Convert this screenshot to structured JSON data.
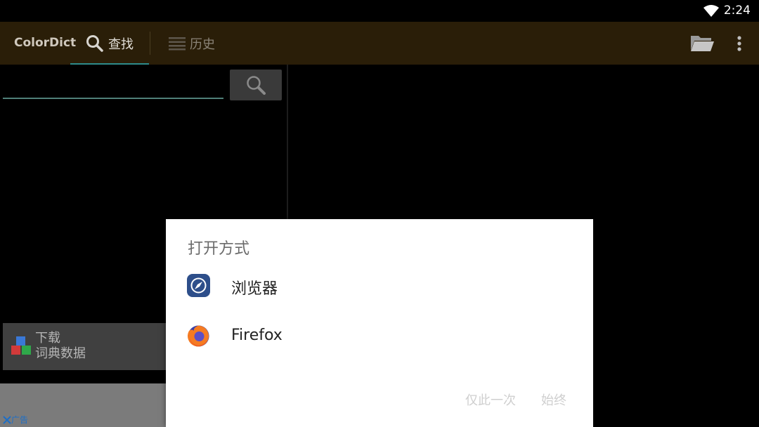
{
  "status_bar": {
    "time": "2:24"
  },
  "app_bar": {
    "title": "ColorDict",
    "tabs": [
      {
        "label": "查找",
        "icon": "search-icon",
        "active": true
      },
      {
        "label": "历史",
        "icon": "list-icon",
        "active": false
      }
    ]
  },
  "search": {
    "value": ""
  },
  "download": {
    "line1": "下载",
    "line2": "词典数据"
  },
  "ad": {
    "label": "广告"
  },
  "dialog": {
    "title": "打开方式",
    "items": [
      {
        "label": "浏览器",
        "icon": "compass-icon"
      },
      {
        "label": "Firefox",
        "icon": "firefox-icon"
      }
    ],
    "actions": {
      "once": "仅此一次",
      "always": "始终"
    }
  },
  "colors": {
    "app_bar_bg": "#2a1e08",
    "accent": "#2e8b8b",
    "dialog_bg": "#ffffff"
  }
}
